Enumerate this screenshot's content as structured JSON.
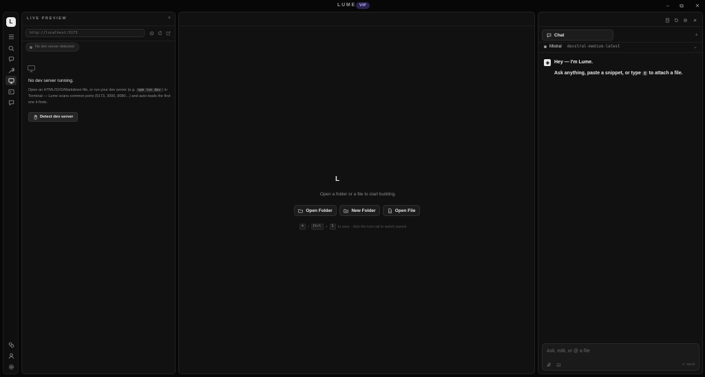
{
  "titlebar": {
    "app_name": "LUME",
    "badge": "VIP",
    "min": "–",
    "max": "⧉",
    "close": "✕"
  },
  "rail": {
    "logo": "L",
    "top_icons": [
      "menu-icon",
      "search-icon",
      "git-icon",
      "wrench-icon",
      "monitor-icon",
      "terminal-icon",
      "chat-bubble-icon"
    ],
    "bottom_icons": [
      "link-icon",
      "user-icon",
      "gear-icon"
    ],
    "active": "monitor-icon"
  },
  "live_preview": {
    "header": "LIVE PREVIEW",
    "close": "×",
    "url_placeholder": "http://localhost:5173",
    "status_chip": "No dev server detected",
    "empty_title": "No dev server running.",
    "desc_part1": "Open an HTML/SVG/Markdown file, or run your dev server (e.g. ",
    "desc_code": "npm run dev",
    "desc_part2": ") in Terminal — Lume scans common ports (5173, 3000, 8080…) and auto-loads the first one it finds.",
    "detect_button": "Detect dev server"
  },
  "center": {
    "logo": "L",
    "prompt": "Open a folder or a file to start building.",
    "open_folder": "Open Folder",
    "new_folder": "New Folder",
    "open_file": "Open File",
    "hint_key1": "⌘",
    "hint_sep1": "/",
    "hint_key2": "Ctrl",
    "hint_plus": "+",
    "hint_key3": "S",
    "hint_text": "to save · click the icon rail to switch panels"
  },
  "chat": {
    "tab_label": "Chat",
    "add": "+",
    "model_provider": "Mistral",
    "model_name": "devstral-medium-latest",
    "model_more": "⌄",
    "greeting": "Hey — I'm Lume.",
    "message_part1": "Ask anything, paste a snippet, or type ",
    "message_at": "@",
    "message_part2": " to attach a file.",
    "composer_placeholder": "Ask, edit, or @ a file",
    "send_label": "↵ send"
  },
  "colors": {
    "background": "#070707",
    "panel": "#111111",
    "badge_bg": "#2b2350",
    "badge_text": "#c8b8ff"
  }
}
